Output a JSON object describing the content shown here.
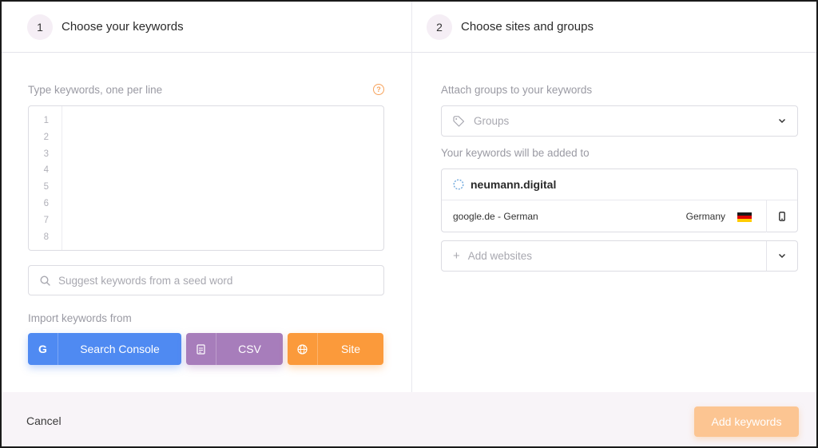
{
  "colors": {
    "accent_orange": "#fb9a3b",
    "search_console_blue": "#4f8af2",
    "csv_purple": "#a77dbb",
    "add_disabled": "#fcc592"
  },
  "step1": {
    "number": "1",
    "title": "Choose your keywords",
    "keywords_label": "Type keywords, one per line",
    "help_icon": "question-circle-icon",
    "line_numbers": [
      "1",
      "2",
      "3",
      "4",
      "5",
      "6",
      "7",
      "8"
    ],
    "seed_placeholder": "Suggest keywords from a seed word",
    "import_label": "Import keywords from",
    "import_buttons": {
      "search_console": {
        "label": "Search Console",
        "icon": "google-icon"
      },
      "csv": {
        "label": "CSV",
        "icon": "file-icon"
      },
      "site": {
        "label": "Site",
        "icon": "globe-icon"
      }
    }
  },
  "step2": {
    "number": "2",
    "title": "Choose sites and groups",
    "groups_label": "Attach groups to your keywords",
    "groups_placeholder": "Groups",
    "added_to_label": "Your keywords will be added to",
    "site": {
      "domain": "neumann.digital",
      "engine": "google.de - German",
      "country": "Germany",
      "device_icon": "mobile-icon"
    },
    "add_websites_placeholder": "Add websites"
  },
  "footer": {
    "cancel_label": "Cancel",
    "add_label": "Add keywords"
  }
}
